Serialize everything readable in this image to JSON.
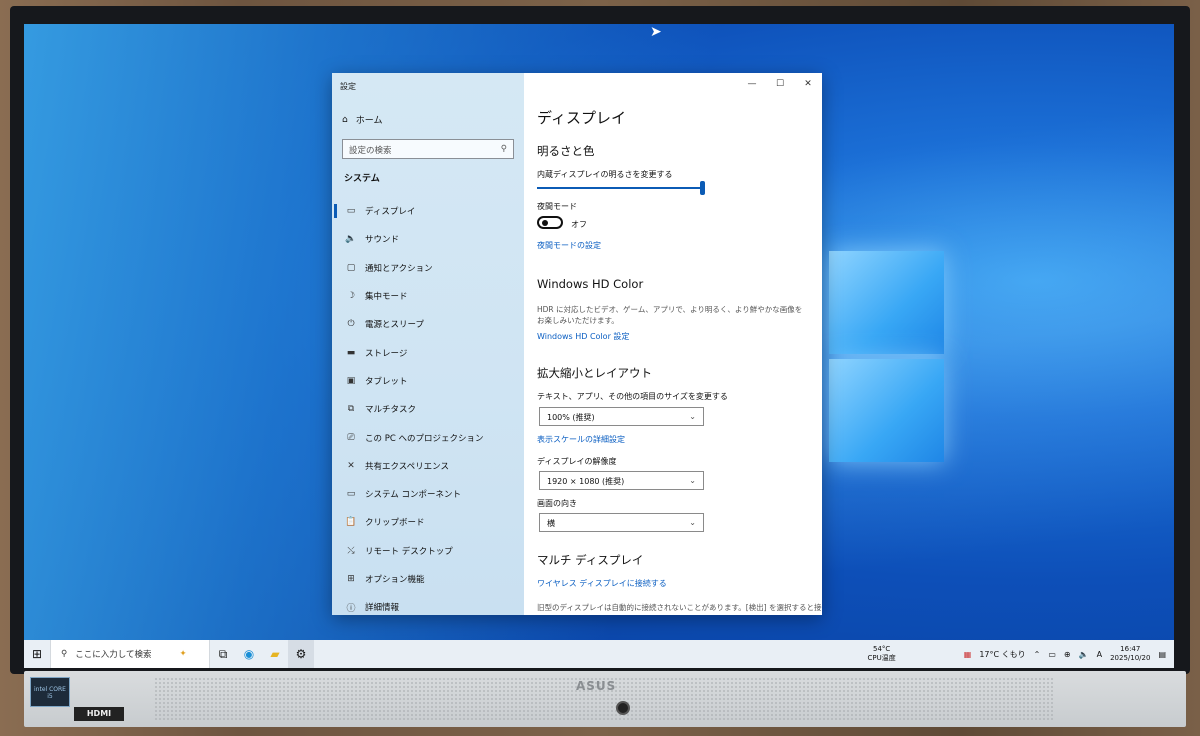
{
  "window": {
    "app_title": "設定",
    "controls": {
      "minimize": "—",
      "maximize": "☐",
      "close": "✕"
    }
  },
  "sidebar": {
    "home_label": "ホーム",
    "search_placeholder": "設定の検索",
    "section_label": "システム",
    "items": [
      {
        "label": "ディスプレイ",
        "icon": "monitor-icon",
        "glyph": "▭"
      },
      {
        "label": "サウンド",
        "icon": "speaker-icon",
        "glyph": "🔈"
      },
      {
        "label": "通知とアクション",
        "icon": "notification-icon",
        "glyph": "▢"
      },
      {
        "label": "集中モード",
        "icon": "moon-icon",
        "glyph": "☽"
      },
      {
        "label": "電源とスリープ",
        "icon": "power-icon",
        "glyph": "⏻"
      },
      {
        "label": "ストレージ",
        "icon": "storage-icon",
        "glyph": "▬"
      },
      {
        "label": "タブレット",
        "icon": "tablet-icon",
        "glyph": "▣"
      },
      {
        "label": "マルチタスク",
        "icon": "multitask-icon",
        "glyph": "⧉"
      },
      {
        "label": "この PC へのプロジェクション",
        "icon": "projection-icon",
        "glyph": "⎚"
      },
      {
        "label": "共有エクスペリエンス",
        "icon": "share-icon",
        "glyph": "✕"
      },
      {
        "label": "システム コンポーネント",
        "icon": "components-icon",
        "glyph": "▭"
      },
      {
        "label": "クリップボード",
        "icon": "clipboard-icon",
        "glyph": "📋"
      },
      {
        "label": "リモート デスクトップ",
        "icon": "remote-icon",
        "glyph": "⤯"
      },
      {
        "label": "オプション機能",
        "icon": "features-icon",
        "glyph": "⊞"
      },
      {
        "label": "詳細情報",
        "icon": "info-icon",
        "glyph": "ⓘ"
      }
    ]
  },
  "main": {
    "page_title": "ディスプレイ",
    "brightness": {
      "heading": "明るさと色",
      "slider_label": "内蔵ディスプレイの明るさを変更する",
      "level_percent": 100
    },
    "night_mode": {
      "label": "夜間モード",
      "state": "オフ",
      "settings_link": "夜間モードの設定"
    },
    "hdr": {
      "heading": "Windows HD Color",
      "description": "HDR に対応したビデオ、ゲーム、アプリで、より明るく、より鮮やかな画像をお楽しみいただけます。",
      "link": "Windows HD Color 設定"
    },
    "scale": {
      "heading": "拡大縮小とレイアウト",
      "scale_label": "テキスト、アプリ、その他の項目のサイズを変更する",
      "scale_value": "100% (推奨)",
      "advanced_link": "表示スケールの詳細設定",
      "resolution_label": "ディスプレイの解像度",
      "resolution_value": "1920 × 1080 (推奨)",
      "orientation_label": "画面の向き",
      "orientation_value": "横"
    },
    "multi": {
      "heading": "マルチ ディスプレイ",
      "link": "ワイヤレス ディスプレイに接続する",
      "note": "旧型のディスプレイは自動的に接続されないことがあります。[検出] を選択すると接"
    }
  },
  "taskbar": {
    "search_placeholder": "ここに入力して検索",
    "cpu_temp": "54°C",
    "cpu_label": "CPU温度",
    "weather": "17°C くもり",
    "ime": "A",
    "time": "16:47",
    "date": "2025/10/20"
  },
  "monitor": {
    "brand": "ASUS",
    "port_label": "HDMI",
    "cpu_badge": "intel CORE i5"
  }
}
